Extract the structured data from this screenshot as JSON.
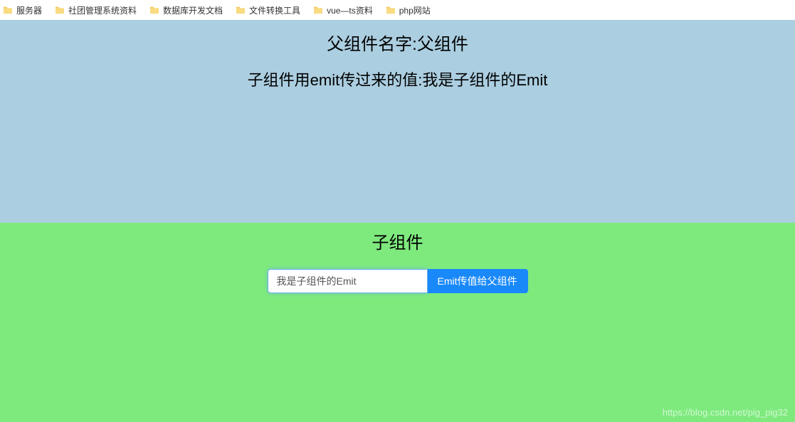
{
  "bookmarks": {
    "items": [
      {
        "label": "服务器"
      },
      {
        "label": "社团管理系统资料"
      },
      {
        "label": "数据库开发文档"
      },
      {
        "label": "文件转换工具"
      },
      {
        "label": "vue—ts资料"
      },
      {
        "label": "php网站"
      }
    ]
  },
  "parent": {
    "title": "父组件名字:父组件",
    "emit_text": "子组件用emit传过来的值:我是子组件的Emit"
  },
  "child": {
    "title": "子组件",
    "input_value": "我是子组件的Emit",
    "button_label": "Emit传值给父组件"
  },
  "watermark": "https://blog.csdn.net/pig_pig32"
}
